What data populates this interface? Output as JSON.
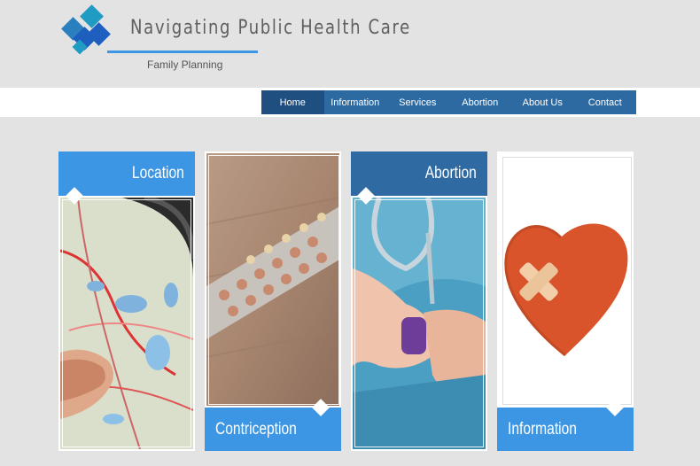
{
  "header": {
    "title": "Navigating Public Health Care",
    "subtitle": "Family Planning",
    "logo_colors": [
      "#1f9bc4",
      "#2a7fbf",
      "#1c5fbf",
      "#38a3c9",
      "#1f9bc4"
    ]
  },
  "nav": {
    "items": [
      {
        "label": "Home",
        "active": true
      },
      {
        "label": "Information",
        "active": false
      },
      {
        "label": "Services",
        "active": false
      },
      {
        "label": "Abortion",
        "active": false
      },
      {
        "label": "About Us",
        "active": false
      },
      {
        "label": "Contact",
        "active": false
      }
    ]
  },
  "cards": [
    {
      "label": "Location",
      "image": "map-photo"
    },
    {
      "label": "Contriception",
      "image": "birth-control-pills-photo"
    },
    {
      "label": "Abortion",
      "image": "nurse-holding-hand-photo"
    },
    {
      "label": "Information",
      "image": "bandaged-heart-photo"
    }
  ],
  "colors": {
    "accent": "#3d96e3",
    "nav_bg": "#2d6aa2",
    "nav_active": "#1f4f80",
    "abortion_label": "#2f6aa3",
    "page_bg": "#e3e3e3"
  }
}
